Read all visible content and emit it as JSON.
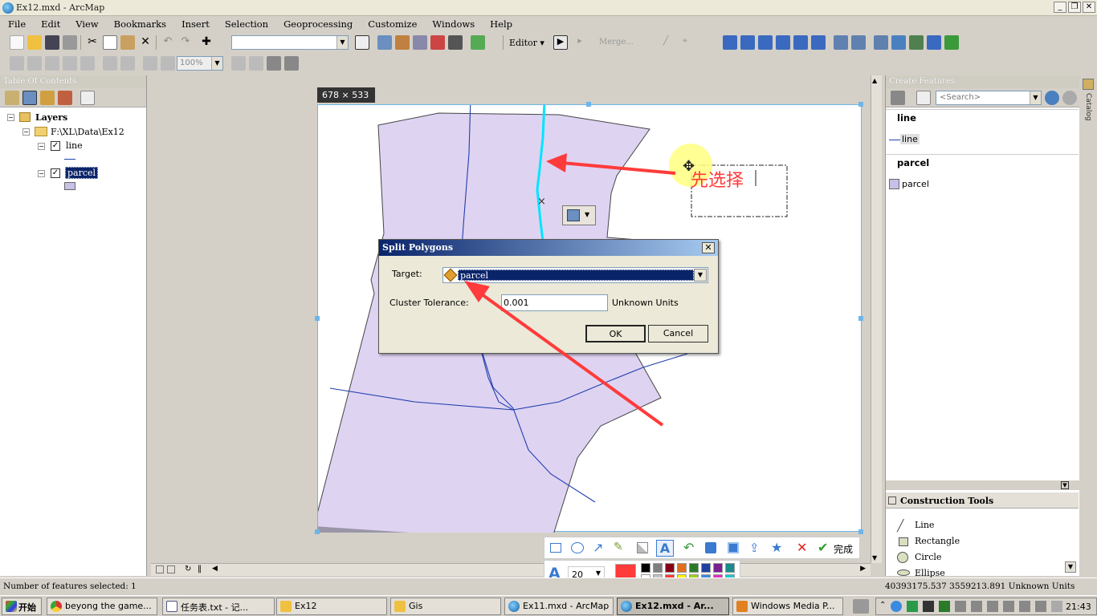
{
  "window": {
    "title": "Ex12.mxd - ArcMap"
  },
  "menu": [
    "File",
    "Edit",
    "View",
    "Bookmarks",
    "Insert",
    "Selection",
    "Geoprocessing",
    "Customize",
    "Windows",
    "Help"
  ],
  "toolbar": {
    "editor_label": "Editor ▾",
    "merge_label": "Merge...",
    "zoom_value": "100%"
  },
  "toc": {
    "title": "Table Of Contents",
    "root": "Layers",
    "folder": "F:\\XL\\Data\\Ex12",
    "layers": [
      {
        "name": "line",
        "checked": true
      },
      {
        "name": "parcel",
        "checked": true,
        "selected": true
      }
    ]
  },
  "map": {
    "size_label": "678 × 533",
    "annotation_text": "先选择"
  },
  "dialog": {
    "title": "Split Polygons",
    "target_label": "Target:",
    "target_value": "parcel",
    "tolerance_label": "Cluster Tolerance:",
    "tolerance_value": "0.001",
    "units": "Unknown Units",
    "ok": "OK",
    "cancel": "Cancel"
  },
  "create_features": {
    "title": "Create Features",
    "search_placeholder": "<Search>",
    "groups": [
      {
        "header": "line",
        "item": "line"
      },
      {
        "header": "parcel",
        "item": "parcel"
      }
    ]
  },
  "construction_tools": {
    "title": "Construction Tools",
    "items": [
      "Line",
      "Rectangle",
      "Circle",
      "Ellipse"
    ]
  },
  "annotation_toolbar": {
    "done_label": "完成",
    "font_size": "20"
  },
  "colors": {
    "accent": "#ff3b3b",
    "parcel_fill": "#dfd3f2",
    "line_blue": "#1f3fae",
    "selected_line": "#00e5ff"
  },
  "status": {
    "selected": "Number of features selected: 1",
    "coords": "40393175.537  3559213.891 Unknown Units"
  },
  "taskbar": {
    "start": "开始",
    "tasks": [
      "beyong the game...",
      "任务表.txt - 记...",
      "Ex12",
      "Gis",
      "Ex11.mxd - ArcMap",
      "Ex12.mxd - Ar...",
      "Windows Media P..."
    ],
    "clock": "21:43"
  }
}
